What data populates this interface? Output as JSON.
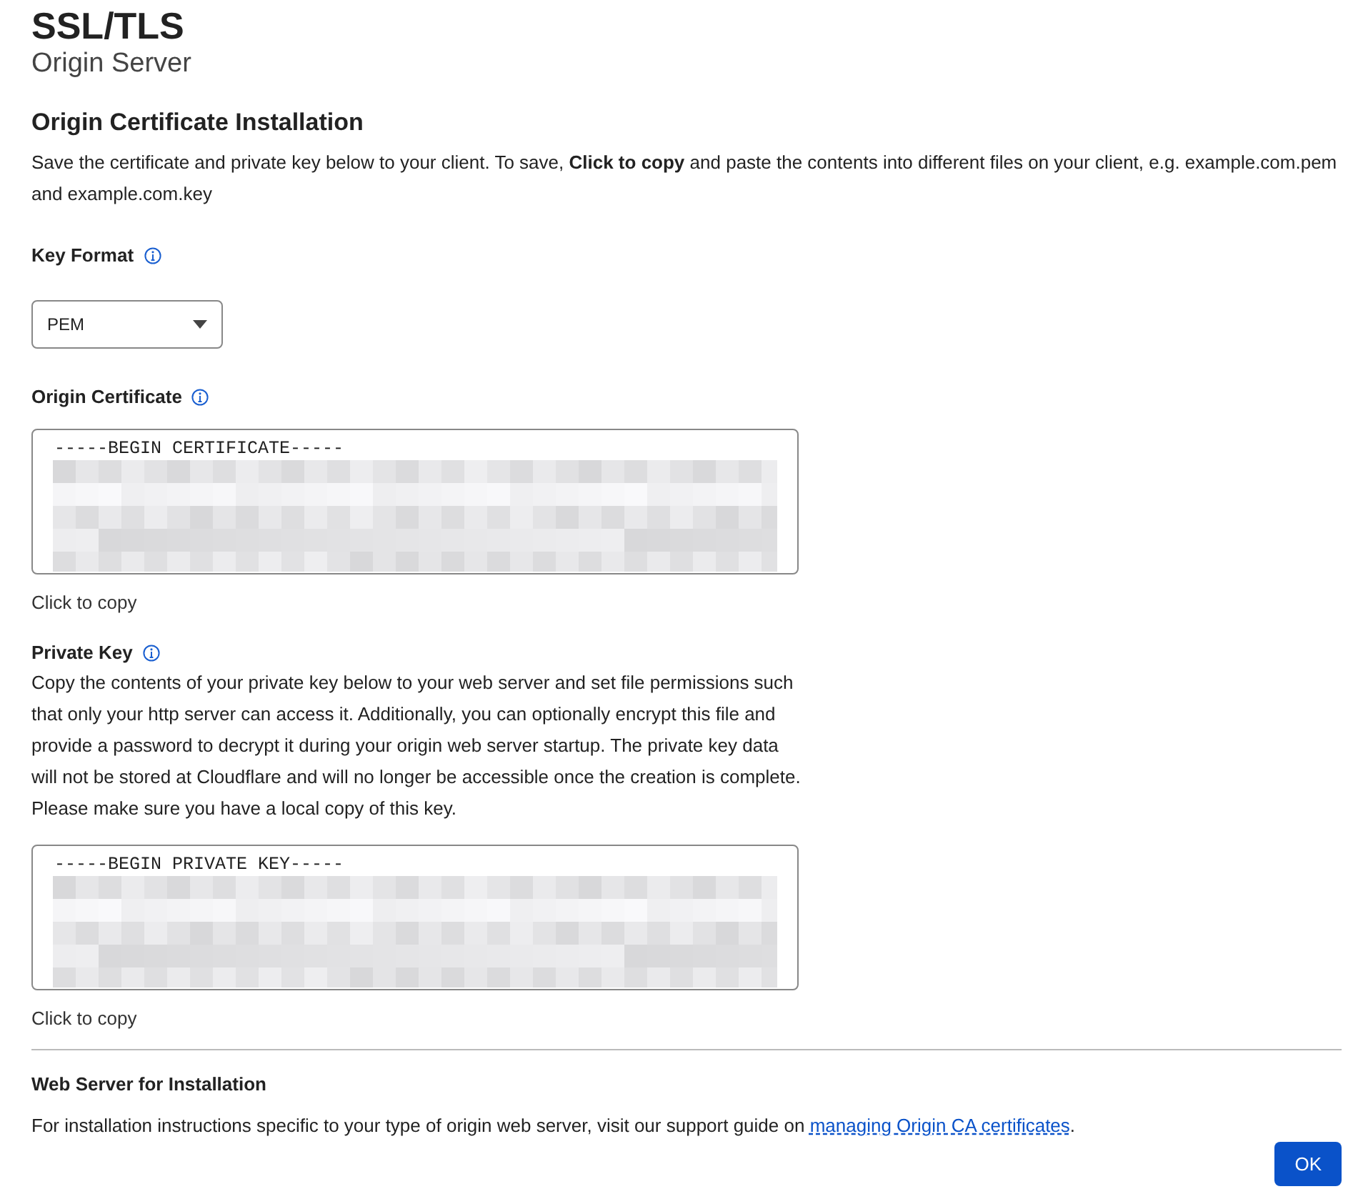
{
  "header": {
    "title": "SSL/TLS",
    "subtitle": "Origin Server"
  },
  "section": {
    "heading": "Origin Certificate Installation",
    "intro": "Save the certificate and private key below to your client. To save, **Click to copy** and paste the contents into different files on your client, e.g. example.com.pem and example.com.key"
  },
  "key_format": {
    "label": "Key Format",
    "value": "PEM"
  },
  "fields": [
    {
      "label": "Origin Certificate",
      "first_line": "-----BEGIN CERTIFICATE-----",
      "copy_link": "Click to copy"
    },
    {
      "label": "Private Key",
      "description": "Copy the contents of your private key below to your web server and set file permissions such that only your http server can access it. Additionally, you can optionally encrypt this file and provide a password to decrypt it during your origin web server startup. The private key data will not be stored at Cloudflare and will no longer be accessible once the creation is complete. Please make sure you have a local copy of this key.",
      "first_line": "-----BEGIN PRIVATE KEY-----",
      "copy_link": "Click to copy"
    }
  ],
  "web_server": {
    "heading": "Web Server for Installation",
    "text": "For installation instructions specific to your type of origin web server, visit our support guide on ",
    "link": "managing Origin CA certificates",
    "after_link": "."
  },
  "buttons": [
    "OK"
  ]
}
